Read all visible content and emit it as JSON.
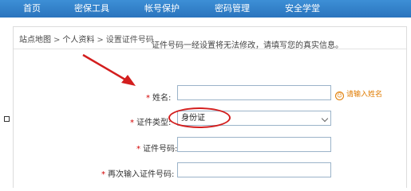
{
  "nav": {
    "items": [
      "首页",
      "密保工具",
      "帐号保护",
      "密码管理",
      "安全学堂"
    ]
  },
  "breadcrumb": {
    "root": "站点地图",
    "separator": ">",
    "section": "个人资料",
    "current": "设置证件号码"
  },
  "notice": "证件号码一经设置将无法修改，请填写您的真实信息。",
  "form": {
    "required_mark": "*",
    "name_label": "姓名:",
    "name_value": "",
    "name_hint": "请输入姓名",
    "idtype_label": "证件类型:",
    "idtype_value": "身份证",
    "idnumber_label": "证件号码:",
    "idnumber_value": "",
    "confirm_label": "再次输入证件号码:",
    "confirm_value": ""
  },
  "colors": {
    "nav_bg": "#2a74bd",
    "required": "#d40000",
    "hint": "#e07b00",
    "annotation": "#d31e1e"
  }
}
